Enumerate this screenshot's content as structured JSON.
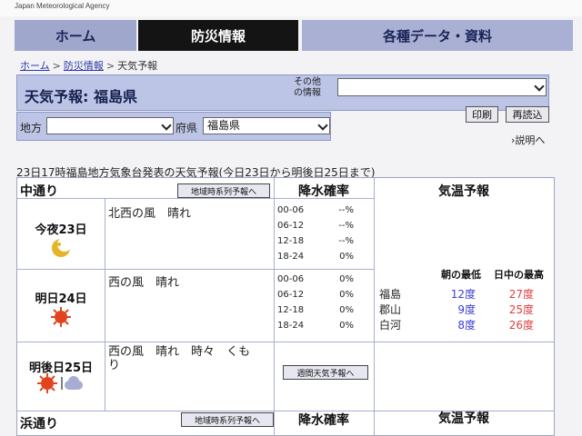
{
  "header": {
    "agency": "Japan Meteorological Agency"
  },
  "nav": {
    "home": "ホーム",
    "bosai": "防災情報",
    "data": "各種データ・資料"
  },
  "breadcrumb": {
    "home": "ホーム",
    "bosai": "防災情報",
    "current": "天気予報",
    "sep": ">"
  },
  "title": "天気予報: 福島県",
  "other_info": {
    "label1": "その他",
    "label2": "の情報",
    "value": ""
  },
  "region": {
    "label": "地方",
    "value": ""
  },
  "prefecture": {
    "label": "府県",
    "value": "福島県"
  },
  "buttons": {
    "print": "印刷",
    "reload": "再読込",
    "explain": "説明へ"
  },
  "announcement": "23日17時福島地方気象台発表の天気予報(今日23日から明後日25日まで)",
  "section1": {
    "name": "中通り",
    "timeseries_btn": "地域時系列予報へ",
    "precip_header": "降水確率",
    "temp_header": "気温予報",
    "days": [
      {
        "label": "今夜23日",
        "icon": "moon-night-icon",
        "weather": "北西の風　晴れ",
        "precip": [
          {
            "time": "00-06",
            "value": "--%"
          },
          {
            "time": "06-12",
            "value": "--%"
          },
          {
            "time": "12-18",
            "value": "--%"
          },
          {
            "time": "18-24",
            "value": "0%"
          }
        ]
      },
      {
        "label": "明日24日",
        "icon": "sun-icon",
        "weather": "西の風　晴れ",
        "precip": [
          {
            "time": "00-06",
            "value": "0%"
          },
          {
            "time": "06-12",
            "value": "0%"
          },
          {
            "time": "12-18",
            "value": "0%"
          },
          {
            "time": "18-24",
            "value": "0%"
          }
        ]
      },
      {
        "label": "明後日25日",
        "icon": "sun-cloud-icon",
        "weather_line1": "西の風　晴れ　時々　くも",
        "weather_line2": "り",
        "weekly_btn": "週間天気予報へ"
      }
    ],
    "temps": {
      "min_header": "朝の最低",
      "max_header": "日中の最高",
      "rows": [
        {
          "city": "福島",
          "min": "12度",
          "max": "27度"
        },
        {
          "city": "郡山",
          "min": "9度",
          "max": "25度"
        },
        {
          "city": "白河",
          "min": "8度",
          "max": "26度"
        }
      ]
    }
  },
  "section2": {
    "name": "浜通り",
    "timeseries_btn": "地域時系列予報へ",
    "precip_header": "降水確率",
    "temp_header": "気温予報"
  },
  "colors": {
    "min_temp": "#3b3bd6",
    "max_temp": "#e03d3d",
    "nav_active": "#141414"
  }
}
